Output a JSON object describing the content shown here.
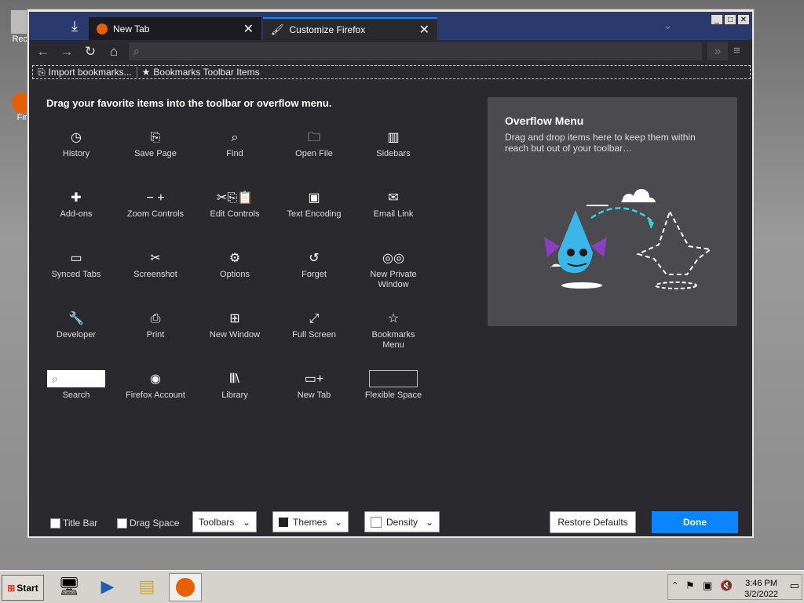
{
  "desktop": {
    "icon1_label": "Recy",
    "icon2_label": "Fir"
  },
  "browser": {
    "tabs": [
      {
        "label": "New Tab",
        "active": false
      },
      {
        "label": "Customize Firefox",
        "active": true
      }
    ],
    "window_controls": [
      "_",
      "□",
      "×"
    ],
    "url_placeholder": "",
    "bookmarks_toolbar": {
      "import_label": "Import bookmarks...",
      "toolbar_items_label": "Bookmarks Toolbar Items"
    }
  },
  "customize": {
    "heading": "Drag your favorite items into the toolbar or overflow menu.",
    "items": [
      {
        "label": "History",
        "icon": "history-icon",
        "glyph": "◷"
      },
      {
        "label": "Save Page",
        "icon": "save-page-icon",
        "glyph": "⎘"
      },
      {
        "label": "Find",
        "icon": "find-icon",
        "glyph": "⌕"
      },
      {
        "label": "Open File",
        "icon": "open-file-icon",
        "glyph": "🗀"
      },
      {
        "label": "Sidebars",
        "icon": "sidebars-icon",
        "glyph": "▥"
      },
      {
        "label": "Add-ons",
        "icon": "addons-icon",
        "glyph": "✚"
      },
      {
        "label": "Zoom Controls",
        "icon": "zoom-icon",
        "glyph": "− +"
      },
      {
        "label": "Edit Controls",
        "icon": "edit-controls-icon",
        "glyph": "✂⎘📋"
      },
      {
        "label": "Text Encoding",
        "icon": "text-encoding-icon",
        "glyph": "▣"
      },
      {
        "label": "Email Link",
        "icon": "email-icon",
        "glyph": "✉"
      },
      {
        "label": "Synced Tabs",
        "icon": "synced-tabs-icon",
        "glyph": "▭"
      },
      {
        "label": "Screenshot",
        "icon": "screenshot-icon",
        "glyph": "✂"
      },
      {
        "label": "Options",
        "icon": "options-icon",
        "glyph": "⚙"
      },
      {
        "label": "Forget",
        "icon": "forget-icon",
        "glyph": "↺"
      },
      {
        "label": "New Private Window",
        "icon": "private-window-icon",
        "glyph": "◎◎"
      },
      {
        "label": "Developer",
        "icon": "developer-icon",
        "glyph": "🔧"
      },
      {
        "label": "Print",
        "icon": "print-icon",
        "glyph": "⎙"
      },
      {
        "label": "New Window",
        "icon": "new-window-icon",
        "glyph": "⊞"
      },
      {
        "label": "Full Screen",
        "icon": "full-screen-icon",
        "glyph": "⤢"
      },
      {
        "label": "Bookmarks Menu",
        "icon": "bookmarks-menu-icon",
        "glyph": "☆"
      },
      {
        "label": "Search",
        "icon": "search-icon",
        "glyph": "⌕"
      },
      {
        "label": "Firefox Account",
        "icon": "account-icon",
        "glyph": "◉"
      },
      {
        "label": "Library",
        "icon": "library-icon",
        "glyph": "𝄃𝄃\\"
      },
      {
        "label": "New Tab",
        "icon": "new-tab-icon",
        "glyph": "▭+"
      },
      {
        "label": "Flexible Space",
        "icon": "flexible-space-icon",
        "glyph": ""
      }
    ],
    "overflow": {
      "title": "Overflow Menu",
      "description": "Drag and drop items here to keep them within reach but out of your toolbar…"
    },
    "bottom": {
      "title_bar": "Title Bar",
      "drag_space": "Drag Space",
      "toolbars": "Toolbars",
      "themes": "Themes",
      "density": "Density",
      "restore": "Restore Defaults",
      "done": "Done"
    }
  },
  "taskbar": {
    "start": "Start",
    "time": "3:46 PM",
    "date": "3/2/2022"
  },
  "colors": {
    "accent": "#0a84ff",
    "panel": "#2a2a2e"
  }
}
